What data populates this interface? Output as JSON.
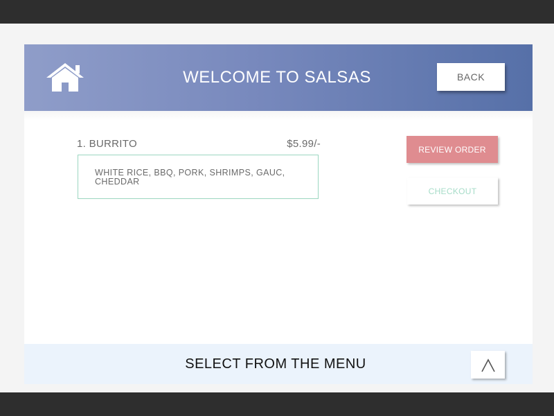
{
  "header": {
    "title": "WELCOME TO SALSAS",
    "back_label": "BACK",
    "home_icon": "home-icon"
  },
  "menu_item": {
    "name": "1. BURRITO",
    "price": "$5.99/-",
    "description": "WHITE RICE, BBQ, PORK, SHRIMPS, GAUC, CHEDDAR"
  },
  "actions": {
    "review_label": "REVIEW ORDER",
    "checkout_label": "CHECKOUT"
  },
  "footer": {
    "text": "SELECT FROM THE MENU",
    "up_icon": "chevron-up-icon"
  },
  "colors": {
    "header_start": "#8f9dc9",
    "header_end": "#5670a8",
    "review_button": "#df8c90",
    "checkout_text": "#a6dcc8",
    "item_border": "#9bd6c0",
    "footer_bg": "#ebf3fc"
  }
}
